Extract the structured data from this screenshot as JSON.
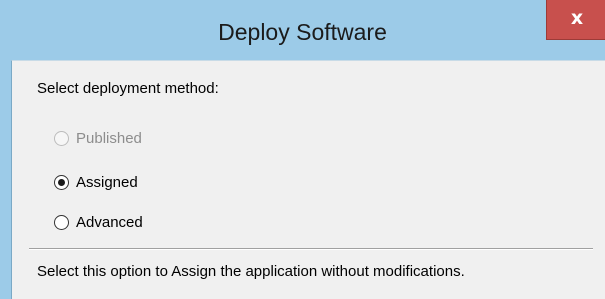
{
  "window": {
    "title": "Deploy Software",
    "close_label": "x"
  },
  "dialog": {
    "prompt": "Select deployment method:",
    "options": [
      {
        "label": "Published",
        "checked": false,
        "enabled": false
      },
      {
        "label": "Assigned",
        "checked": true,
        "enabled": true
      },
      {
        "label": "Advanced",
        "checked": false,
        "enabled": true
      }
    ],
    "description": "Select this option to Assign the application without modifications."
  },
  "colors": {
    "titlebar_bg": "#9ccbe8",
    "close_button_bg": "#c8504d",
    "client_bg": "#f0f0f0",
    "disabled_text": "#8d8d8d"
  },
  "icons": {
    "close": "close-icon",
    "radio": "radio-button-icon"
  }
}
